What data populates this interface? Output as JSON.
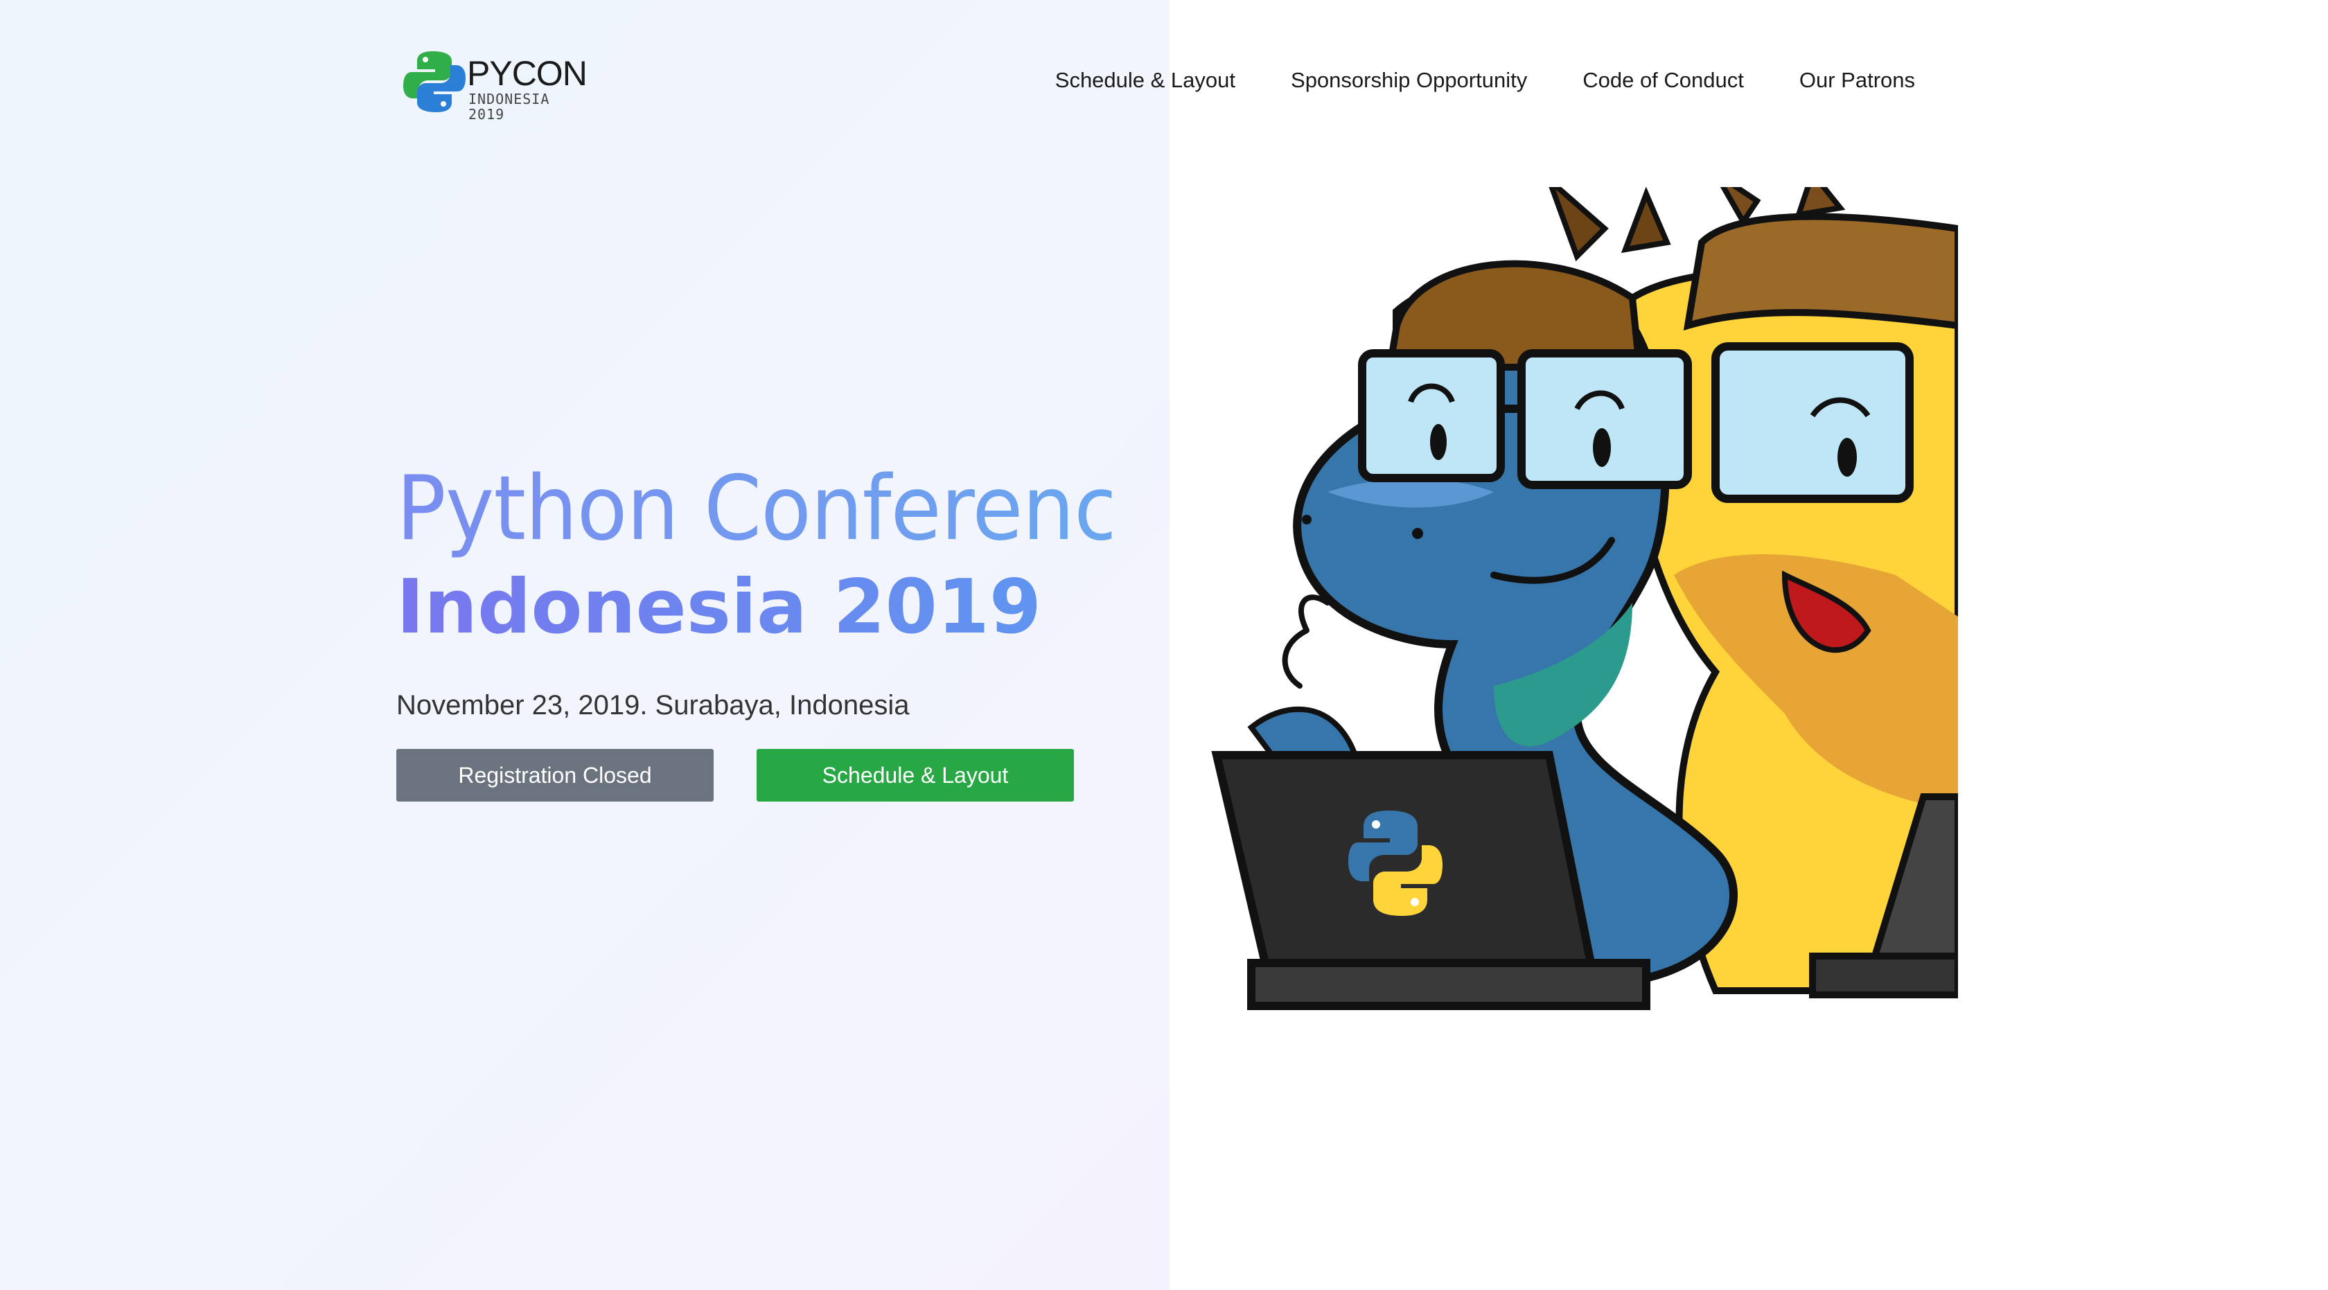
{
  "brand": {
    "logo_word": "PYCON",
    "logo_sub": "INDONESIA 2019"
  },
  "nav": {
    "items": [
      {
        "label": "Schedule & Layout"
      },
      {
        "label": "Sponsorship Opportunity"
      },
      {
        "label": "Code of Conduct"
      },
      {
        "label": "Our Patrons"
      }
    ]
  },
  "hero": {
    "title_light": "Python Conference",
    "title_bold": "Indonesia 2019",
    "date_location": "November 23, 2019. Surabaya, Indonesia",
    "buttons": {
      "registration": "Registration Closed",
      "schedule": "Schedule & Layout"
    }
  },
  "colors": {
    "button_closed": "#6b747e",
    "button_schedule": "#28a745",
    "title_gradient_start": "#7877ee",
    "title_gradient_end": "#5b9af0"
  },
  "icons": {
    "logo": "python-logo-icon",
    "illustration": "python-mascots-illustration"
  }
}
